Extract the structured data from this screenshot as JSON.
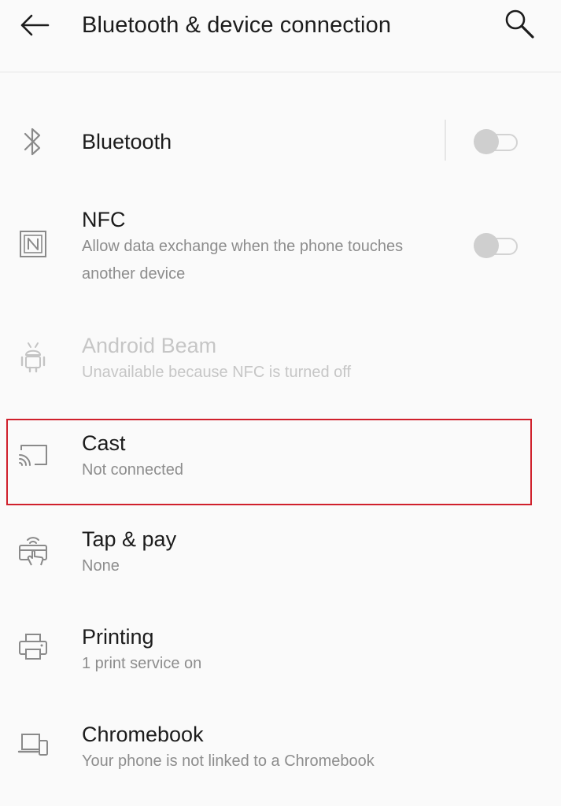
{
  "header": {
    "title": "Bluetooth & device connection",
    "back_icon": "arrow-left-icon",
    "search_icon": "search-icon"
  },
  "items": [
    {
      "id": "bluetooth",
      "title": "Bluetooth",
      "subtitle": "",
      "icon": "bluetooth-icon",
      "toggle": "off"
    },
    {
      "id": "nfc",
      "title": "NFC",
      "subtitle": "Allow data exchange when the phone touches another device",
      "icon": "nfc-icon",
      "toggle": "off"
    },
    {
      "id": "android-beam",
      "title": "Android Beam",
      "subtitle": "Unavailable because NFC is turned off",
      "icon": "android-icon",
      "disabled": true
    },
    {
      "id": "cast",
      "title": "Cast",
      "subtitle": "Not connected",
      "icon": "cast-icon",
      "highlighted": true
    },
    {
      "id": "tap-pay",
      "title": "Tap & pay",
      "subtitle": "None",
      "icon": "tap-pay-icon"
    },
    {
      "id": "printing",
      "title": "Printing",
      "subtitle": "1 print service on",
      "icon": "printer-icon"
    },
    {
      "id": "chromebook",
      "title": "Chromebook",
      "subtitle": "Your phone is not linked to a Chromebook",
      "icon": "chromebook-icon"
    }
  ],
  "colors": {
    "background": "#fafafa",
    "title_text": "#1c1c1c",
    "subtitle_text": "#8d8d8d",
    "disabled_text": "#c6c6c6",
    "highlight": "#d0202c"
  }
}
